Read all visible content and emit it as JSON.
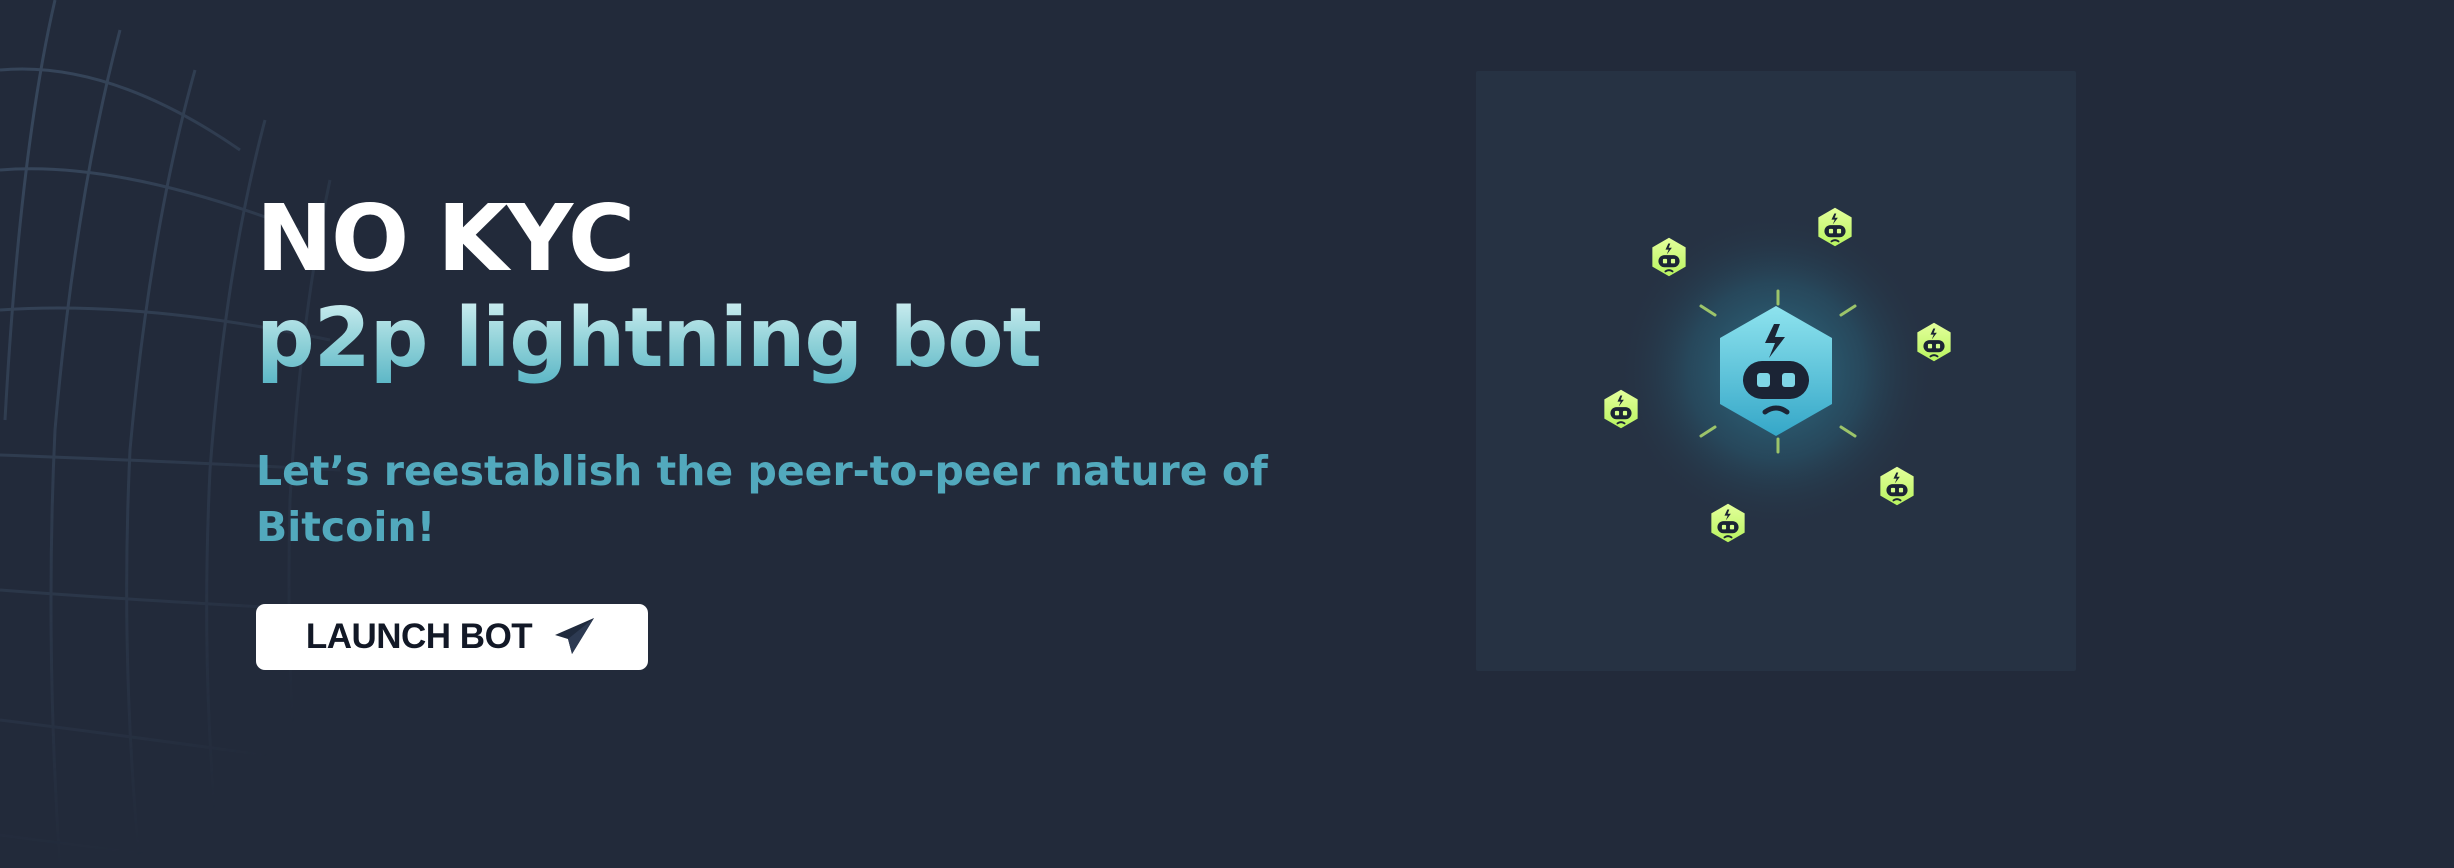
{
  "hero": {
    "title": "NO KYC",
    "subtitle": "p2p lightning bot",
    "tagline": "Let’s reestablish the peer-to-peer nature of Bitcoin!"
  },
  "launch_button": {
    "label": "LAUNCH BOT",
    "icon": "paper-plane-icon"
  },
  "illustration": {
    "center_icon": "robot-hexagon-icon",
    "orbit_icon": "robot-hexagon-icon",
    "orbit_count": 6
  },
  "colors": {
    "background": "#222a3a",
    "panel": "#263243",
    "accent_teal": "#52a9bd",
    "accent_green": "#c5f96d"
  }
}
